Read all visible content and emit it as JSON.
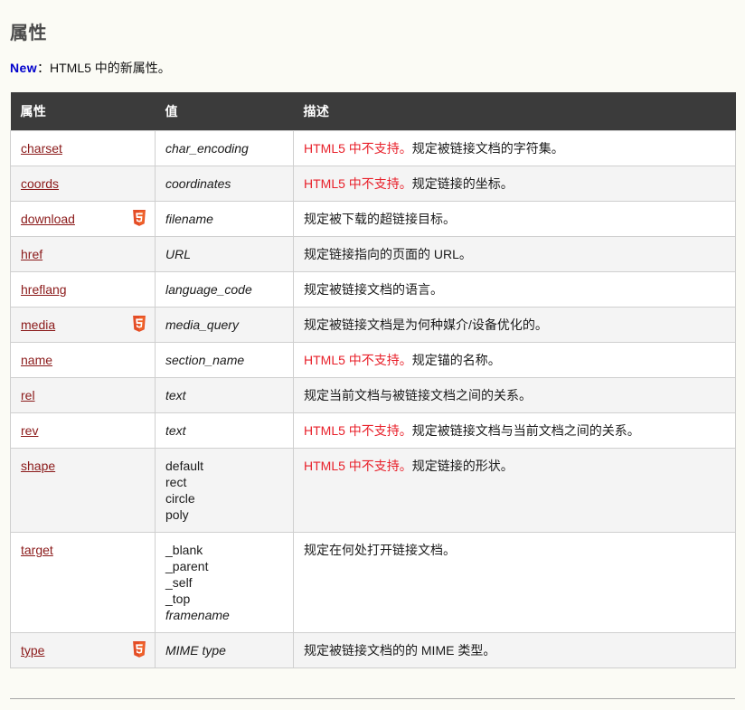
{
  "heading": "属性",
  "new_note": {
    "tag": "New",
    "rest": "：HTML5 中的新属性。"
  },
  "colors": {
    "header_bg": "#3b3b3b",
    "header_text": "#ffffff",
    "link": "#8b1a1a",
    "warning": "#e8202a",
    "new_tag": "#0000cc",
    "page_bg": "#fbfbf5",
    "row_alt_bg": "#f4f4f4",
    "badge_orange": "#e44d26",
    "badge_orange_light": "#f16529"
  },
  "table": {
    "columns": [
      "属性",
      "值",
      "描述"
    ],
    "rows": [
      {
        "attr": "charset",
        "html5_badge": false,
        "badge_icon": "",
        "values": [
          {
            "text": "char_encoding",
            "italic": true
          }
        ],
        "warning": "HTML5 中不支持。",
        "description": "规定被链接文档的字符集。"
      },
      {
        "attr": "coords",
        "html5_badge": false,
        "badge_icon": "",
        "values": [
          {
            "text": "coordinates",
            "italic": true
          }
        ],
        "warning": "HTML5 中不支持。",
        "description": "规定链接的坐标。"
      },
      {
        "attr": "download",
        "html5_badge": true,
        "badge_icon": "html5-badge-icon",
        "values": [
          {
            "text": "filename",
            "italic": true
          }
        ],
        "warning": "",
        "description": "规定被下载的超链接目标。"
      },
      {
        "attr": "href",
        "html5_badge": false,
        "badge_icon": "",
        "values": [
          {
            "text": "URL",
            "italic": true
          }
        ],
        "warning": "",
        "description": "规定链接指向的页面的 URL。"
      },
      {
        "attr": "hreflang",
        "html5_badge": false,
        "badge_icon": "",
        "values": [
          {
            "text": "language_code",
            "italic": true
          }
        ],
        "warning": "",
        "description": "规定被链接文档的语言。"
      },
      {
        "attr": "media",
        "html5_badge": true,
        "badge_icon": "html5-badge-icon",
        "values": [
          {
            "text": "media_query",
            "italic": true
          }
        ],
        "warning": "",
        "description": "规定被链接文档是为何种媒介/设备优化的。"
      },
      {
        "attr": "name",
        "html5_badge": false,
        "badge_icon": "",
        "values": [
          {
            "text": "section_name",
            "italic": true
          }
        ],
        "warning": "HTML5 中不支持。",
        "description": "规定锚的名称。"
      },
      {
        "attr": "rel",
        "html5_badge": false,
        "badge_icon": "",
        "values": [
          {
            "text": "text",
            "italic": true
          }
        ],
        "warning": "",
        "description": "规定当前文档与被链接文档之间的关系。"
      },
      {
        "attr": "rev",
        "html5_badge": false,
        "badge_icon": "",
        "values": [
          {
            "text": "text",
            "italic": true
          }
        ],
        "warning": "HTML5 中不支持。",
        "description": "规定被链接文档与当前文档之间的关系。"
      },
      {
        "attr": "shape",
        "html5_badge": false,
        "badge_icon": "",
        "values": [
          {
            "text": "default",
            "italic": false
          },
          {
            "text": "rect",
            "italic": false
          },
          {
            "text": "circle",
            "italic": false
          },
          {
            "text": "poly",
            "italic": false
          }
        ],
        "warning": "HTML5 中不支持。",
        "description": "规定链接的形状。"
      },
      {
        "attr": "target",
        "html5_badge": false,
        "badge_icon": "",
        "values": [
          {
            "text": "_blank",
            "italic": false
          },
          {
            "text": "_parent",
            "italic": false
          },
          {
            "text": "_self",
            "italic": false
          },
          {
            "text": "_top",
            "italic": false
          },
          {
            "text": "framename",
            "italic": true
          }
        ],
        "warning": "",
        "description": "规定在何处打开链接文档。"
      },
      {
        "attr": "type",
        "html5_badge": true,
        "badge_icon": "html5-badge-icon",
        "values": [
          {
            "text": "MIME type",
            "italic": true
          }
        ],
        "warning": "",
        "description": "规定被链接文档的的 MIME 类型。"
      }
    ]
  }
}
